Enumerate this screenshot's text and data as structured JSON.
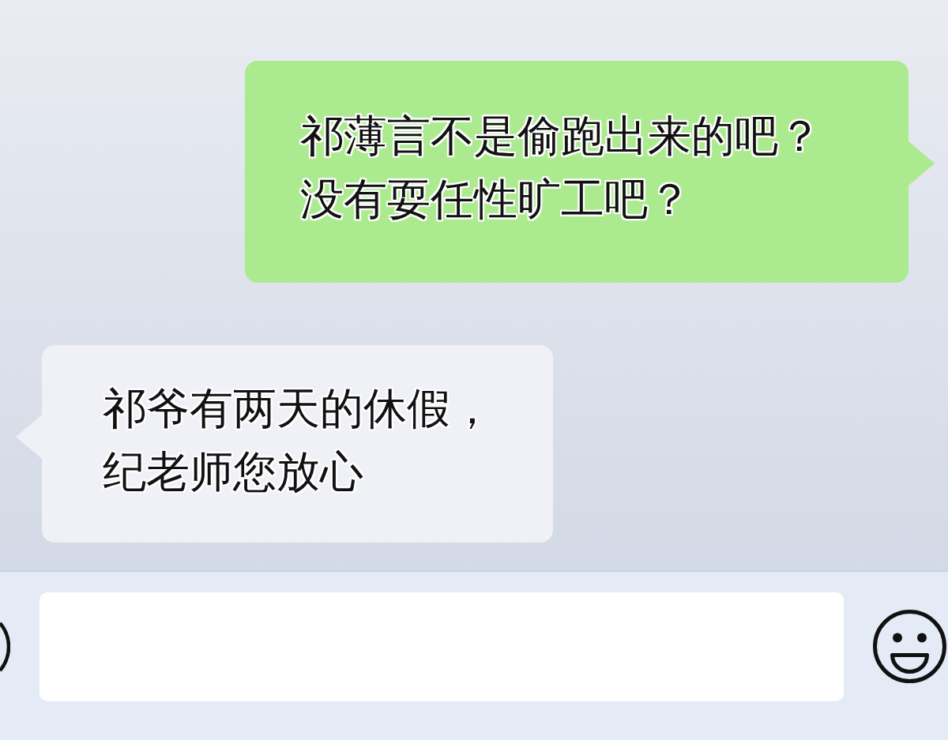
{
  "messages": [
    {
      "kind": "sent",
      "text": "祁薄言不是偷跑出来的吧？没有耍任性旷工吧？"
    },
    {
      "kind": "received",
      "text": "祁爷有两天的休假，纪老师您放心"
    }
  ]
}
